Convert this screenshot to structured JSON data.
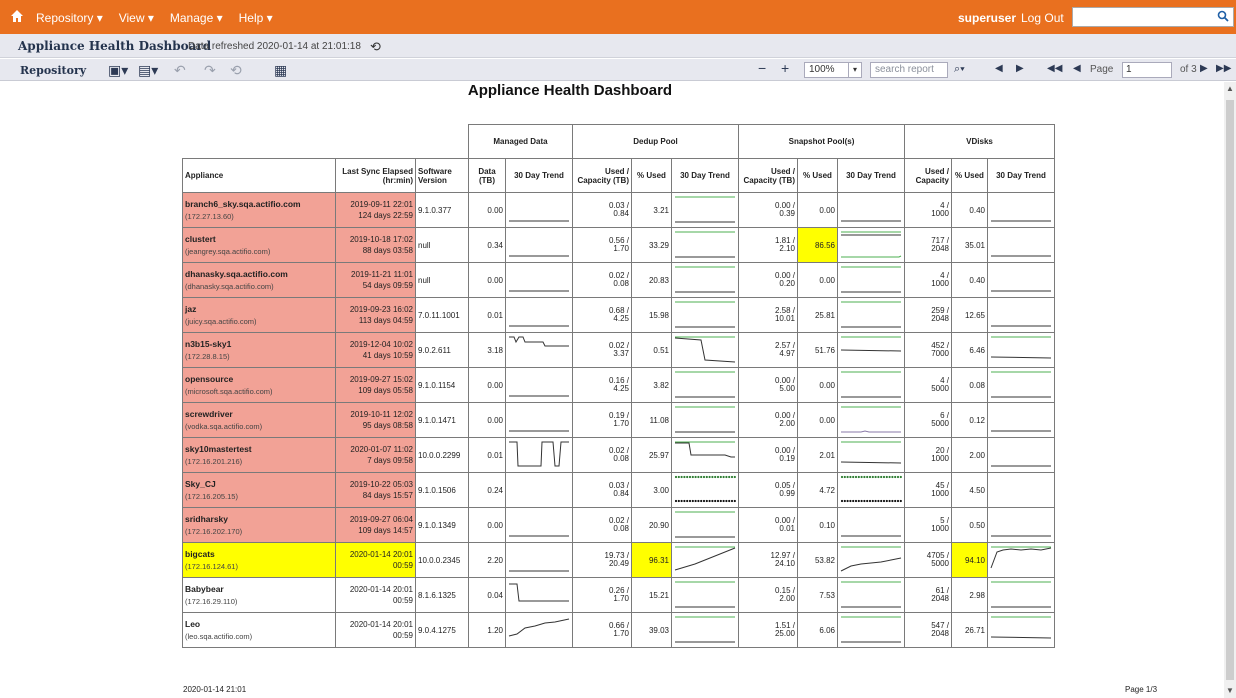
{
  "topbar": {
    "menu": [
      "Repository ▾",
      "View ▾",
      "Manage ▾",
      "Help ▾"
    ],
    "user": "superuser",
    "logout": "Log Out",
    "search_value": ""
  },
  "subhead": {
    "title": "Appliance Health Dashboard",
    "refreshed": "Data refreshed 2020-01-14 at 21:01:18"
  },
  "toolbar": {
    "repository": "Repository",
    "zoom": "100%",
    "search_placeholder": "search report",
    "page_label": "Page",
    "page_value": "1",
    "page_of": "of 3"
  },
  "report": {
    "title": "Appliance Health Dashboard",
    "groups": [
      "Managed Data",
      "Dedup Pool",
      "Snapshot Pool(s)",
      "VDisks"
    ],
    "columns": {
      "appliance": "Appliance",
      "last_sync": "Last Sync Elapsed (hr:min)",
      "software": "Software Version",
      "data_tb": "Data (TB)",
      "trend": "30 Day Trend",
      "used_cap_tb": "Used / Capacity (TB)",
      "pct_used": "% Used",
      "used_cap": "Used / Capacity"
    },
    "rows": [
      {
        "name": "branch6_sky.sqa.actifio.com",
        "host": "(172.27.13.60)",
        "sync": "2019-09-11 22:01",
        "elapsed": "124 days 22:59",
        "sw": "9.1.0.377",
        "data": "0.00",
        "dd_used": "0.03 /",
        "dd_cap": "0.84",
        "dd_pct": "3.21",
        "sn_used": "0.00 /",
        "sn_cap": "0.39",
        "sn_pct": "0.00",
        "vd_used": "4 /",
        "vd_cap": "1000",
        "vd_pct": "0.40",
        "status": "red"
      },
      {
        "name": "clustert",
        "host": "(jeangrey.sqa.actifio.com)",
        "sync": "2019-10-18 17:02",
        "elapsed": "88 days 03:58",
        "sw": "null",
        "data": "0.34",
        "dd_used": "0.56 /",
        "dd_cap": "1.70",
        "dd_pct": "33.29",
        "sn_used": "1.81 /",
        "sn_cap": "2.10",
        "sn_pct": "86.56",
        "vd_used": "717 /",
        "vd_cap": "2048",
        "vd_pct": "35.01",
        "status": "red"
      },
      {
        "name": "dhanasky.sqa.actifio.com",
        "host": "(dhanasky.sqa.actifio.com)",
        "sync": "2019-11-21 11:01",
        "elapsed": "54 days 09:59",
        "sw": "null",
        "data": "0.00",
        "dd_used": "0.02 /",
        "dd_cap": "0.08",
        "dd_pct": "20.83",
        "sn_used": "0.00 /",
        "sn_cap": "0.20",
        "sn_pct": "0.00",
        "vd_used": "4 /",
        "vd_cap": "1000",
        "vd_pct": "0.40",
        "status": "red"
      },
      {
        "name": "jaz",
        "host": "(juicy.sqa.actifio.com)",
        "sync": "2019-09-23 16:02",
        "elapsed": "113 days 04:59",
        "sw": "7.0.11.1001",
        "data": "0.01",
        "dd_used": "0.68 /",
        "dd_cap": "4.25",
        "dd_pct": "15.98",
        "sn_used": "2.58 /",
        "sn_cap": "10.01",
        "sn_pct": "25.81",
        "vd_used": "259 /",
        "vd_cap": "2048",
        "vd_pct": "12.65",
        "status": "red"
      },
      {
        "name": "n3b15-sky1",
        "host": "(172.28.8.15)",
        "sync": "2019-12-04 10:02",
        "elapsed": "41 days 10:59",
        "sw": "9.0.2.611",
        "data": "3.18",
        "dd_used": "0.02 /",
        "dd_cap": "3.37",
        "dd_pct": "0.51",
        "sn_used": "2.57 /",
        "sn_cap": "4.97",
        "sn_pct": "51.76",
        "vd_used": "452 /",
        "vd_cap": "7000",
        "vd_pct": "6.46",
        "status": "red"
      },
      {
        "name": "opensource",
        "host": "(microsoft.sqa.actifio.com)",
        "sync": "2019-09-27 15:02",
        "elapsed": "109 days 05:58",
        "sw": "9.1.0.1154",
        "data": "0.00",
        "dd_used": "0.16 /",
        "dd_cap": "4.25",
        "dd_pct": "3.82",
        "sn_used": "0.00 /",
        "sn_cap": "5.00",
        "sn_pct": "0.00",
        "vd_used": "4 /",
        "vd_cap": "5000",
        "vd_pct": "0.08",
        "status": "red"
      },
      {
        "name": "screwdriver",
        "host": "(vodka.sqa.actifio.com)",
        "sync": "2019-10-11 12:02",
        "elapsed": "95 days 08:58",
        "sw": "9.1.0.1471",
        "data": "0.00",
        "dd_used": "0.19 /",
        "dd_cap": "1.70",
        "dd_pct": "11.08",
        "sn_used": "0.00 /",
        "sn_cap": "2.00",
        "sn_pct": "0.00",
        "vd_used": "6 /",
        "vd_cap": "5000",
        "vd_pct": "0.12",
        "status": "red"
      },
      {
        "name": "sky10mastertest",
        "host": "(172.16.201.216)",
        "sync": "2020-01-07 11:02",
        "elapsed": "7 days 09:58",
        "sw": "10.0.0.2299",
        "data": "0.01",
        "dd_used": "0.02 /",
        "dd_cap": "0.08",
        "dd_pct": "25.97",
        "sn_used": "0.00 /",
        "sn_cap": "0.19",
        "sn_pct": "2.01",
        "vd_used": "20 /",
        "vd_cap": "1000",
        "vd_pct": "2.00",
        "status": "red"
      },
      {
        "name": "Sky_CJ",
        "host": "(172.16.205.15)",
        "sync": "2019-10-22 05:03",
        "elapsed": "84 days 15:57",
        "sw": "9.1.0.1506",
        "data": "0.24",
        "dd_used": "0.03 /",
        "dd_cap": "0.84",
        "dd_pct": "3.00",
        "sn_used": "0.05 /",
        "sn_cap": "0.99",
        "sn_pct": "4.72",
        "vd_used": "45 /",
        "vd_cap": "1000",
        "vd_pct": "4.50",
        "status": "red"
      },
      {
        "name": "sridharsky",
        "host": "(172.16.202.170)",
        "sync": "2019-09-27 06:04",
        "elapsed": "109 days 14:57",
        "sw": "9.1.0.1349",
        "data": "0.00",
        "dd_used": "0.02 /",
        "dd_cap": "0.08",
        "dd_pct": "20.90",
        "sn_used": "0.00 /",
        "sn_cap": "0.01",
        "sn_pct": "0.10",
        "vd_used": "5 /",
        "vd_cap": "1000",
        "vd_pct": "0.50",
        "status": "red"
      },
      {
        "name": "bigcats",
        "host": "(172.16.124.61)",
        "sync": "2020-01-14 20:01",
        "elapsed": "00:59",
        "sw": "10.0.0.2345",
        "data": "2.20",
        "dd_used": "19.73 /",
        "dd_cap": "20.49",
        "dd_pct": "96.31",
        "sn_used": "12.97 /",
        "sn_cap": "24.10",
        "sn_pct": "53.82",
        "vd_used": "4705 /",
        "vd_cap": "5000",
        "vd_pct": "94.10",
        "status": "yel"
      },
      {
        "name": "Babybear",
        "host": "(172.16.29.110)",
        "sync": "2020-01-14 20:01",
        "elapsed": "00:59",
        "sw": "8.1.6.1325",
        "data": "0.04",
        "dd_used": "0.26 /",
        "dd_cap": "1.70",
        "dd_pct": "15.21",
        "sn_used": "0.15 /",
        "sn_cap": "2.00",
        "sn_pct": "7.53",
        "vd_used": "61 /",
        "vd_cap": "2048",
        "vd_pct": "2.98",
        "status": "ok"
      },
      {
        "name": "Leo",
        "host": "(leo.sqa.actifio.com)",
        "sync": "2020-01-14 20:01",
        "elapsed": "00:59",
        "sw": "9.0.4.1275",
        "data": "1.20",
        "dd_used": "0.66 /",
        "dd_cap": "1.70",
        "dd_pct": "39.03",
        "sn_used": "1.51 /",
        "sn_cap": "25.00",
        "sn_pct": "6.06",
        "vd_used": "547 /",
        "vd_cap": "2048",
        "vd_pct": "26.71",
        "status": "ok"
      }
    ],
    "footer_date": "2020-01-14 21:01",
    "footer_page": "Page 1/3"
  },
  "colors": {
    "topbar": "#e9701f",
    "alert_red": "#f2a296",
    "alert_yellow": "#ffff00",
    "trend_line": "#333333",
    "capacity_line": "#4caf50"
  }
}
